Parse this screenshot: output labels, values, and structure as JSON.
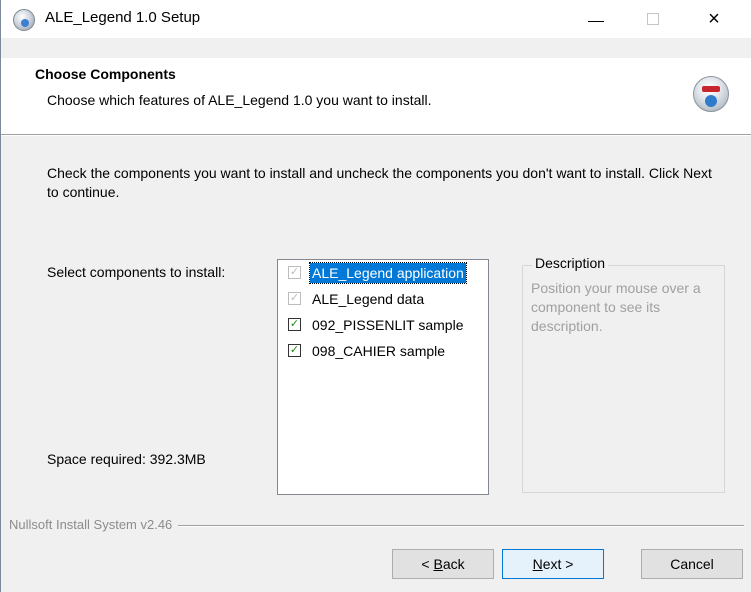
{
  "window": {
    "title": "ALE_Legend 1.0 Setup",
    "controls": {
      "minimize": "minimize",
      "maximize": "maximize",
      "close": "×"
    }
  },
  "header": {
    "title": "Choose Components",
    "subtitle": "Choose which features of ALE_Legend 1.0 you want to install.",
    "icon": "installer-disc-icon"
  },
  "body": {
    "instructions": "Check the components you want to install and uncheck the components you don't want to install. Click Next to continue.",
    "select_label": "Select components to install:",
    "space_required": "Space required: 392.3MB",
    "components": [
      {
        "label": "ALE_Legend application",
        "checked": true,
        "disabled": true,
        "selected": true
      },
      {
        "label": "ALE_Legend data",
        "checked": true,
        "disabled": true,
        "selected": false
      },
      {
        "label": "092_PISSENLIT sample",
        "checked": true,
        "disabled": false,
        "selected": false
      },
      {
        "label": "098_CAHIER sample",
        "checked": true,
        "disabled": false,
        "selected": false
      }
    ],
    "description": {
      "title": "Description",
      "text": "Position your mouse over a component to see its description."
    }
  },
  "footer": {
    "brand": "Nullsoft Install System v2.46",
    "buttons": {
      "back_prefix": "< ",
      "back_mnemonic": "B",
      "back_rest": "ack",
      "next_mnemonic": "N",
      "next_rest": "ext >",
      "cancel": "Cancel"
    }
  },
  "colors": {
    "accent": "#0078d7",
    "checkmark": "#1a8a1a",
    "window_bg": "#f0f0f0"
  }
}
